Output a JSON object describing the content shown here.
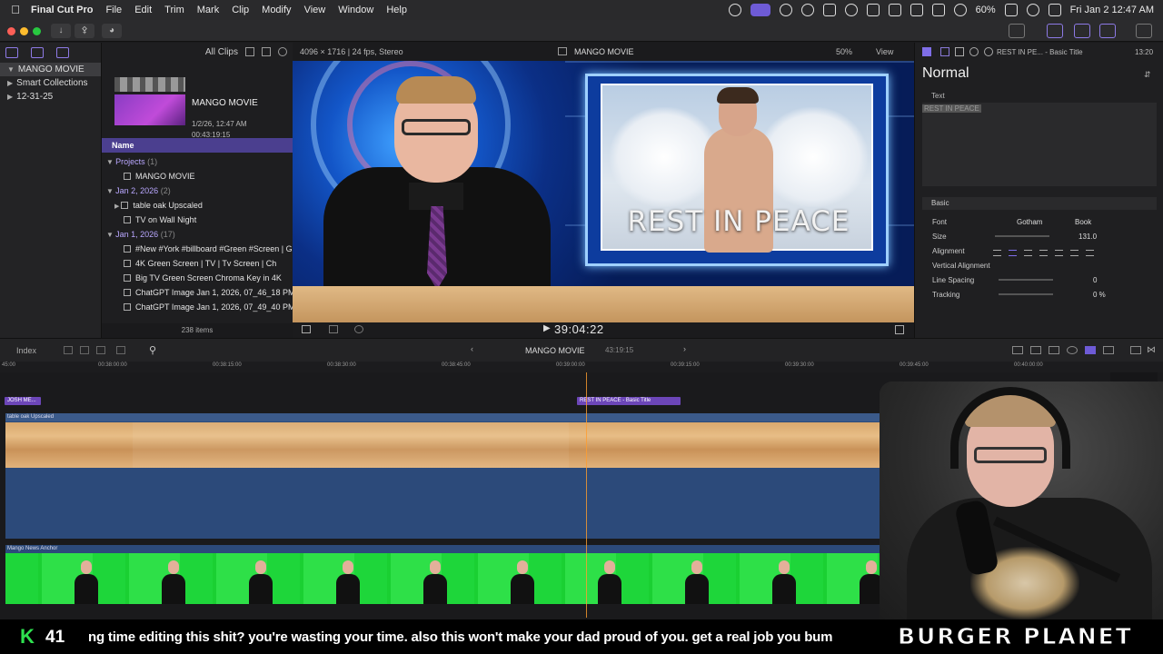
{
  "menubar": {
    "app_name": "Final Cut Pro",
    "items": [
      "File",
      "Edit",
      "Trim",
      "Mark",
      "Clip",
      "Modify",
      "View",
      "Window",
      "Help"
    ],
    "battery": "60%",
    "datetime": "Fri Jan 2  12:47 AM"
  },
  "library": {
    "name": "MANGO MOVIE",
    "items": [
      {
        "label": "MANGO MOVIE",
        "icon": "library-icon"
      },
      {
        "label": "Smart Collections",
        "icon": "folder-icon"
      },
      {
        "label": "12-31-25",
        "icon": "event-icon"
      }
    ]
  },
  "browser": {
    "filter_label": "All Clips",
    "project_card": {
      "title": "MANGO MOVIE",
      "date": "1/2/26, 12:47 AM",
      "duration": "00:43:19:15"
    },
    "column_name": "Name",
    "rows": [
      {
        "type": "group",
        "label": "Projects",
        "count": "(1)"
      },
      {
        "type": "file",
        "label": "MANGO MOVIE"
      },
      {
        "type": "group",
        "label": "Jan 2, 2026",
        "count": "(2)"
      },
      {
        "type": "file",
        "label": "table oak Upscaled"
      },
      {
        "type": "file",
        "label": "TV on Wall Night"
      },
      {
        "type": "group",
        "label": "Jan 1, 2026",
        "count": "(17)"
      },
      {
        "type": "file",
        "label": "#New #York #billboard #Green #Screen | G"
      },
      {
        "type": "file",
        "label": "4K Green Screen | TV | Tv Screen | Ch"
      },
      {
        "type": "file",
        "label": "Big TV Green Screen Chroma Key in 4K"
      },
      {
        "type": "file",
        "label": "ChatGPT Image Jan 1, 2026, 07_46_18 PM"
      },
      {
        "type": "file",
        "label": "ChatGPT Image Jan 1, 2026, 07_49_40 PM"
      }
    ],
    "footer": "238 items"
  },
  "viewer": {
    "format": "4096 × 1716 | 24 fps, Stereo",
    "project_title": "MANGO MOVIE",
    "zoom": "50%",
    "view_label": "View",
    "screen_text": "REST IN PEACE",
    "timecode": "39:04:22"
  },
  "inspector": {
    "header": "REST IN PE... - Basic Title",
    "duration": "13:20",
    "style": "Normal",
    "text_label": "Text",
    "text_value": "REST IN PEACE",
    "section": "Basic",
    "props": {
      "font_label": "Font",
      "font_value": "Gotham",
      "font_weight": "Book",
      "size_label": "Size",
      "size_value": "131.0",
      "alignment_label": "Alignment",
      "valign_label": "Vertical Alignment",
      "line_spacing_label": "Line Spacing",
      "line_spacing_value": "0",
      "tracking_label": "Tracking",
      "tracking_value": "0 %"
    }
  },
  "timeline": {
    "index_label": "Index",
    "project_title": "MANGO MOVIE",
    "duration": "43:19:15",
    "ruler": [
      "00:38:00:00",
      "00:38:15:00",
      "00:38:30:00",
      "00:38:45:00",
      "00:39:00:00",
      "00:39:15:00",
      "00:39:30:00",
      "00:39:45:00",
      "00:40:00:00"
    ],
    "ruler_partial": "45:00",
    "clips": {
      "small": "JOSH ME...",
      "title": "REST IN PEACE - Basic Title",
      "wood": "table oak Upscaled",
      "green": "Mango News Anchor"
    }
  },
  "ticker": {
    "badge_letter": "K",
    "badge_number": "41",
    "message": "ng time editing this shit? you're wasting your time. also this won't make your dad proud of you. get a real job you bum",
    "brand": "BURGER PLANET"
  }
}
